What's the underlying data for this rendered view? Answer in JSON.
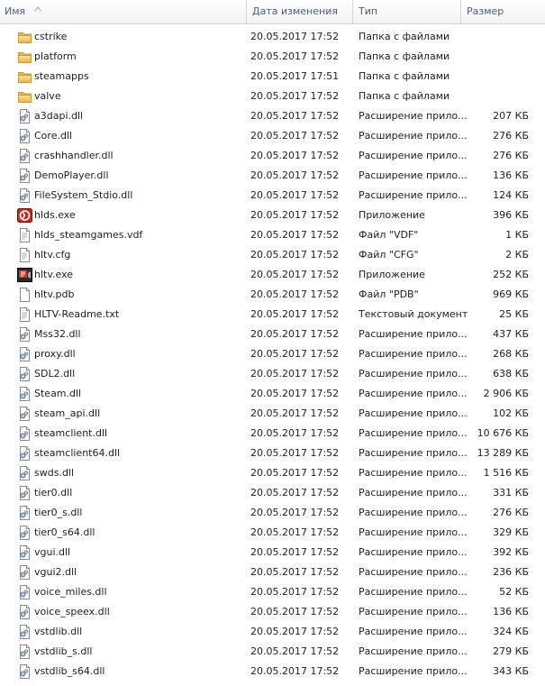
{
  "header": {
    "name": "Имя",
    "date": "Дата изменения",
    "type": "Тип",
    "size": "Размер"
  },
  "rows": [
    {
      "name": "cstrike",
      "date": "20.05.2017 17:52",
      "type": "Папка с файлами",
      "size": "",
      "icon": "folder-icon"
    },
    {
      "name": "platform",
      "date": "20.05.2017 17:52",
      "type": "Папка с файлами",
      "size": "",
      "icon": "folder-icon"
    },
    {
      "name": "steamapps",
      "date": "20.05.2017 17:51",
      "type": "Папка с файлами",
      "size": "",
      "icon": "folder-icon"
    },
    {
      "name": "valve",
      "date": "20.05.2017 17:52",
      "type": "Папка с файлами",
      "size": "",
      "icon": "folder-icon"
    },
    {
      "name": "a3dapi.dll",
      "date": "20.05.2017 17:52",
      "type": "Расширение прило...",
      "size": "207 КБ",
      "icon": "dll-file-icon"
    },
    {
      "name": "Core.dll",
      "date": "20.05.2017 17:52",
      "type": "Расширение прило...",
      "size": "276 КБ",
      "icon": "dll-file-icon"
    },
    {
      "name": "crashhandler.dll",
      "date": "20.05.2017 17:52",
      "type": "Расширение прило...",
      "size": "276 КБ",
      "icon": "dll-file-icon"
    },
    {
      "name": "DemoPlayer.dll",
      "date": "20.05.2017 17:52",
      "type": "Расширение прило...",
      "size": "136 КБ",
      "icon": "dll-file-icon"
    },
    {
      "name": "FileSystem_Stdio.dll",
      "date": "20.05.2017 17:52",
      "type": "Расширение прило...",
      "size": "124 КБ",
      "icon": "dll-file-icon"
    },
    {
      "name": "hlds.exe",
      "date": "20.05.2017 17:52",
      "type": "Приложение",
      "size": "396 КБ",
      "icon": "hlds-exe-icon"
    },
    {
      "name": "hlds_steamgames.vdf",
      "date": "20.05.2017 17:52",
      "type": "Файл \"VDF\"",
      "size": "1 КБ",
      "icon": "text-file-icon"
    },
    {
      "name": "hltv.cfg",
      "date": "20.05.2017 17:52",
      "type": "Файл \"CFG\"",
      "size": "2 КБ",
      "icon": "text-file-icon"
    },
    {
      "name": "hltv.exe",
      "date": "20.05.2017 17:52",
      "type": "Приложение",
      "size": "252 КБ",
      "icon": "hltv-exe-icon"
    },
    {
      "name": "hltv.pdb",
      "date": "20.05.2017 17:52",
      "type": "Файл \"PDB\"",
      "size": "969 КБ",
      "icon": "blank-file-icon"
    },
    {
      "name": "HLTV-Readme.txt",
      "date": "20.05.2017 17:52",
      "type": "Текстовый документ",
      "size": "25 КБ",
      "icon": "text-file-icon"
    },
    {
      "name": "Mss32.dll",
      "date": "20.05.2017 17:52",
      "type": "Расширение прило...",
      "size": "437 КБ",
      "icon": "dll-file-icon"
    },
    {
      "name": "proxy.dll",
      "date": "20.05.2017 17:52",
      "type": "Расширение прило...",
      "size": "268 КБ",
      "icon": "dll-file-icon"
    },
    {
      "name": "SDL2.dll",
      "date": "20.05.2017 17:52",
      "type": "Расширение прило...",
      "size": "638 КБ",
      "icon": "dll-file-icon"
    },
    {
      "name": "Steam.dll",
      "date": "20.05.2017 17:52",
      "type": "Расширение прило...",
      "size": "2 906 КБ",
      "icon": "dll-file-icon"
    },
    {
      "name": "steam_api.dll",
      "date": "20.05.2017 17:52",
      "type": "Расширение прило...",
      "size": "102 КБ",
      "icon": "dll-file-icon"
    },
    {
      "name": "steamclient.dll",
      "date": "20.05.2017 17:52",
      "type": "Расширение прило...",
      "size": "10 676 КБ",
      "icon": "dll-file-icon"
    },
    {
      "name": "steamclient64.dll",
      "date": "20.05.2017 17:52",
      "type": "Расширение прило...",
      "size": "13 289 КБ",
      "icon": "dll-file-icon"
    },
    {
      "name": "swds.dll",
      "date": "20.05.2017 17:52",
      "type": "Расширение прило...",
      "size": "1 516 КБ",
      "icon": "dll-file-icon"
    },
    {
      "name": "tier0.dll",
      "date": "20.05.2017 17:52",
      "type": "Расширение прило...",
      "size": "331 КБ",
      "icon": "dll-file-icon"
    },
    {
      "name": "tier0_s.dll",
      "date": "20.05.2017 17:52",
      "type": "Расширение прило...",
      "size": "276 КБ",
      "icon": "dll-file-icon"
    },
    {
      "name": "tier0_s64.dll",
      "date": "20.05.2017 17:52",
      "type": "Расширение прило...",
      "size": "329 КБ",
      "icon": "dll-file-icon"
    },
    {
      "name": "vgui.dll",
      "date": "20.05.2017 17:52",
      "type": "Расширение прило...",
      "size": "392 КБ",
      "icon": "dll-file-icon"
    },
    {
      "name": "vgui2.dll",
      "date": "20.05.2017 17:52",
      "type": "Расширение прило...",
      "size": "236 КБ",
      "icon": "dll-file-icon"
    },
    {
      "name": "voice_miles.dll",
      "date": "20.05.2017 17:52",
      "type": "Расширение прило...",
      "size": "52 КБ",
      "icon": "dll-file-icon"
    },
    {
      "name": "voice_speex.dll",
      "date": "20.05.2017 17:52",
      "type": "Расширение прило...",
      "size": "136 КБ",
      "icon": "dll-file-icon"
    },
    {
      "name": "vstdlib.dll",
      "date": "20.05.2017 17:52",
      "type": "Расширение прило...",
      "size": "324 КБ",
      "icon": "dll-file-icon"
    },
    {
      "name": "vstdlib_s.dll",
      "date": "20.05.2017 17:52",
      "type": "Расширение прило...",
      "size": "279 КБ",
      "icon": "dll-file-icon"
    },
    {
      "name": "vstdlib_s64.dll",
      "date": "20.05.2017 17:52",
      "type": "Расширение прило...",
      "size": "343 КБ",
      "icon": "dll-file-icon"
    }
  ]
}
